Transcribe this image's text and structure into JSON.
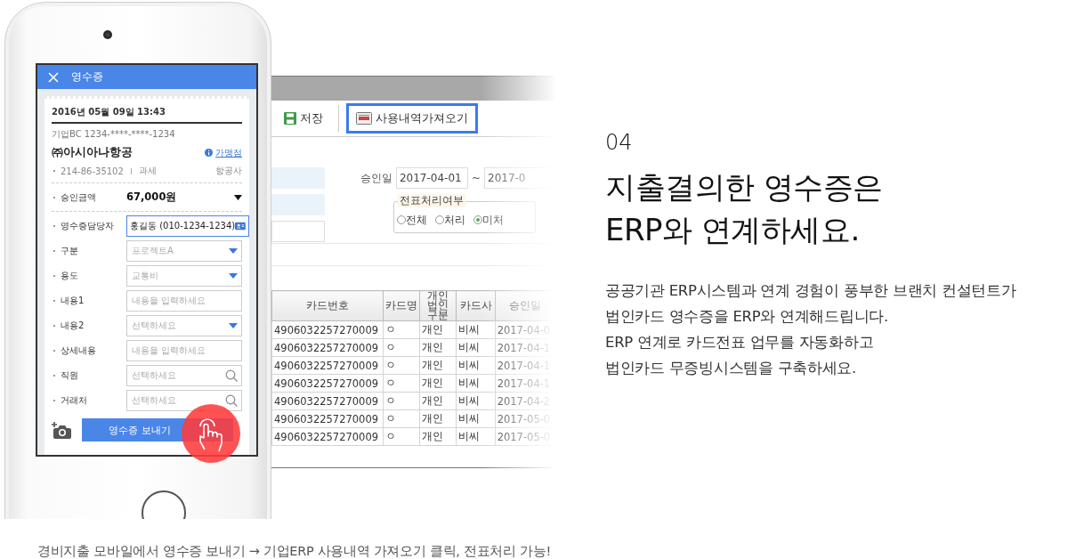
{
  "phone": {
    "title": "영수증",
    "receipt": {
      "datetime": "2016년 05월 09일 13:43",
      "card": "기업BC 1234-****-****-1234",
      "merchant": "㈜아시아나항공",
      "merchant_link": "가맹점",
      "biz_no": "214-86-35102",
      "tax": "과세",
      "category": "항공사",
      "amount_label": "승인금액",
      "amount": "67,000원"
    },
    "fields": [
      {
        "label": "영수증담당자",
        "kind": "contact",
        "value": "홍길동 (010-1234-1234)"
      },
      {
        "label": "구분",
        "kind": "select",
        "placeholder": "프로젝트A"
      },
      {
        "label": "용도",
        "kind": "select",
        "placeholder": "교통비"
      },
      {
        "label": "내용1",
        "kind": "text",
        "placeholder": "내용을 입력하세요"
      },
      {
        "label": "내용2",
        "kind": "select",
        "placeholder": "선택하세요"
      },
      {
        "label": "상세내용",
        "kind": "text",
        "placeholder": "내용을 입력하세요"
      },
      {
        "label": "직원",
        "kind": "search",
        "placeholder": "선택하세요"
      },
      {
        "label": "거래처",
        "kind": "search",
        "placeholder": "선택하세요"
      }
    ],
    "send_button": "영수증 보내기"
  },
  "erp": {
    "toolbar": [
      {
        "label": "저장",
        "kind": "save",
        "selected": false
      },
      {
        "label": "사용내역가져오기",
        "kind": "import",
        "selected": true
      }
    ],
    "date_label": "승인일",
    "date_from": "2017-04-01",
    "date_sep": "~",
    "date_to": "2017-0",
    "group_title": "전표처리여부",
    "radios": [
      {
        "label": "전체",
        "selected": false
      },
      {
        "label": "처리",
        "selected": false
      },
      {
        "label": "미처",
        "selected": true
      }
    ],
    "table": {
      "columns": [
        "카드번호",
        "카드명",
        "개인법인구분",
        "카드사",
        "승인일"
      ],
      "rows": [
        [
          "4906032257270009",
          "ㅇ",
          "개인",
          "비씨",
          "2017-04-0"
        ],
        [
          "4906032257270009",
          "ㅇ",
          "개인",
          "비씨",
          "2017-04-1"
        ],
        [
          "4906032257270009",
          "ㅇ",
          "개인",
          "비씨",
          "2017-04-1"
        ],
        [
          "4906032257270009",
          "ㅇ",
          "개인",
          "비씨",
          "2017-04-1"
        ],
        [
          "4906032257270009",
          "ㅇ",
          "개인",
          "비씨",
          "2017-04-2"
        ],
        [
          "4906032257270009",
          "ㅇ",
          "개인",
          "비씨",
          "2017-05-0"
        ],
        [
          "4906032257270009",
          "ㅇ",
          "개인",
          "비씨",
          "2017-05-0"
        ]
      ]
    }
  },
  "copy": {
    "number": "04",
    "heading": [
      "지출결의한 영수증은",
      "ERP와 연계하세요."
    ],
    "body": [
      "공공기관 ERP시스템과 연계 경험이 풍부한 브랜치 컨설턴트가",
      "법인카드 영수증을 ERP와 연계해드립니다.",
      "ERP 연계로 카드전표 업무를 자동화하고",
      "법인카드 무증빙시스템을 구축하세요."
    ]
  },
  "caption": "경비지출 모바일에서 영수증 보내기 → 기업ERP 사용내역 가져오기 클릭, 전표처리 가능!"
}
